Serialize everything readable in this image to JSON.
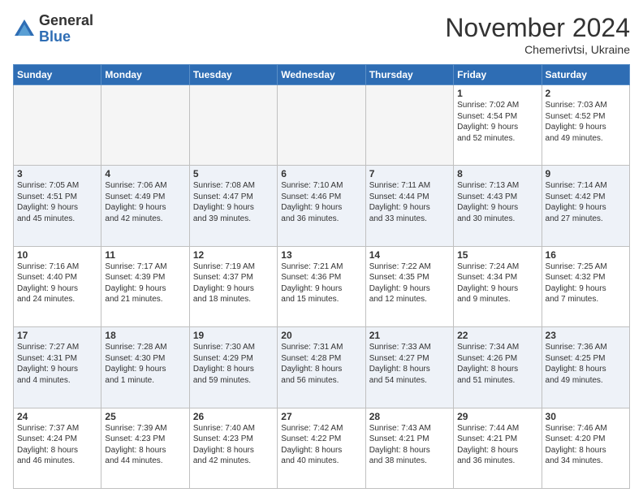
{
  "header": {
    "logo_general": "General",
    "logo_blue": "Blue",
    "month_title": "November 2024",
    "location": "Chemerivtsi, Ukraine"
  },
  "weekdays": [
    "Sunday",
    "Monday",
    "Tuesday",
    "Wednesday",
    "Thursday",
    "Friday",
    "Saturday"
  ],
  "rows": [
    [
      {
        "day": "",
        "info": ""
      },
      {
        "day": "",
        "info": ""
      },
      {
        "day": "",
        "info": ""
      },
      {
        "day": "",
        "info": ""
      },
      {
        "day": "",
        "info": ""
      },
      {
        "day": "1",
        "info": "Sunrise: 7:02 AM\nSunset: 4:54 PM\nDaylight: 9 hours\nand 52 minutes."
      },
      {
        "day": "2",
        "info": "Sunrise: 7:03 AM\nSunset: 4:52 PM\nDaylight: 9 hours\nand 49 minutes."
      }
    ],
    [
      {
        "day": "3",
        "info": "Sunrise: 7:05 AM\nSunset: 4:51 PM\nDaylight: 9 hours\nand 45 minutes."
      },
      {
        "day": "4",
        "info": "Sunrise: 7:06 AM\nSunset: 4:49 PM\nDaylight: 9 hours\nand 42 minutes."
      },
      {
        "day": "5",
        "info": "Sunrise: 7:08 AM\nSunset: 4:47 PM\nDaylight: 9 hours\nand 39 minutes."
      },
      {
        "day": "6",
        "info": "Sunrise: 7:10 AM\nSunset: 4:46 PM\nDaylight: 9 hours\nand 36 minutes."
      },
      {
        "day": "7",
        "info": "Sunrise: 7:11 AM\nSunset: 4:44 PM\nDaylight: 9 hours\nand 33 minutes."
      },
      {
        "day": "8",
        "info": "Sunrise: 7:13 AM\nSunset: 4:43 PM\nDaylight: 9 hours\nand 30 minutes."
      },
      {
        "day": "9",
        "info": "Sunrise: 7:14 AM\nSunset: 4:42 PM\nDaylight: 9 hours\nand 27 minutes."
      }
    ],
    [
      {
        "day": "10",
        "info": "Sunrise: 7:16 AM\nSunset: 4:40 PM\nDaylight: 9 hours\nand 24 minutes."
      },
      {
        "day": "11",
        "info": "Sunrise: 7:17 AM\nSunset: 4:39 PM\nDaylight: 9 hours\nand 21 minutes."
      },
      {
        "day": "12",
        "info": "Sunrise: 7:19 AM\nSunset: 4:37 PM\nDaylight: 9 hours\nand 18 minutes."
      },
      {
        "day": "13",
        "info": "Sunrise: 7:21 AM\nSunset: 4:36 PM\nDaylight: 9 hours\nand 15 minutes."
      },
      {
        "day": "14",
        "info": "Sunrise: 7:22 AM\nSunset: 4:35 PM\nDaylight: 9 hours\nand 12 minutes."
      },
      {
        "day": "15",
        "info": "Sunrise: 7:24 AM\nSunset: 4:34 PM\nDaylight: 9 hours\nand 9 minutes."
      },
      {
        "day": "16",
        "info": "Sunrise: 7:25 AM\nSunset: 4:32 PM\nDaylight: 9 hours\nand 7 minutes."
      }
    ],
    [
      {
        "day": "17",
        "info": "Sunrise: 7:27 AM\nSunset: 4:31 PM\nDaylight: 9 hours\nand 4 minutes."
      },
      {
        "day": "18",
        "info": "Sunrise: 7:28 AM\nSunset: 4:30 PM\nDaylight: 9 hours\nand 1 minute."
      },
      {
        "day": "19",
        "info": "Sunrise: 7:30 AM\nSunset: 4:29 PM\nDaylight: 8 hours\nand 59 minutes."
      },
      {
        "day": "20",
        "info": "Sunrise: 7:31 AM\nSunset: 4:28 PM\nDaylight: 8 hours\nand 56 minutes."
      },
      {
        "day": "21",
        "info": "Sunrise: 7:33 AM\nSunset: 4:27 PM\nDaylight: 8 hours\nand 54 minutes."
      },
      {
        "day": "22",
        "info": "Sunrise: 7:34 AM\nSunset: 4:26 PM\nDaylight: 8 hours\nand 51 minutes."
      },
      {
        "day": "23",
        "info": "Sunrise: 7:36 AM\nSunset: 4:25 PM\nDaylight: 8 hours\nand 49 minutes."
      }
    ],
    [
      {
        "day": "24",
        "info": "Sunrise: 7:37 AM\nSunset: 4:24 PM\nDaylight: 8 hours\nand 46 minutes."
      },
      {
        "day": "25",
        "info": "Sunrise: 7:39 AM\nSunset: 4:23 PM\nDaylight: 8 hours\nand 44 minutes."
      },
      {
        "day": "26",
        "info": "Sunrise: 7:40 AM\nSunset: 4:23 PM\nDaylight: 8 hours\nand 42 minutes."
      },
      {
        "day": "27",
        "info": "Sunrise: 7:42 AM\nSunset: 4:22 PM\nDaylight: 8 hours\nand 40 minutes."
      },
      {
        "day": "28",
        "info": "Sunrise: 7:43 AM\nSunset: 4:21 PM\nDaylight: 8 hours\nand 38 minutes."
      },
      {
        "day": "29",
        "info": "Sunrise: 7:44 AM\nSunset: 4:21 PM\nDaylight: 8 hours\nand 36 minutes."
      },
      {
        "day": "30",
        "info": "Sunrise: 7:46 AM\nSunset: 4:20 PM\nDaylight: 8 hours\nand 34 minutes."
      }
    ]
  ]
}
